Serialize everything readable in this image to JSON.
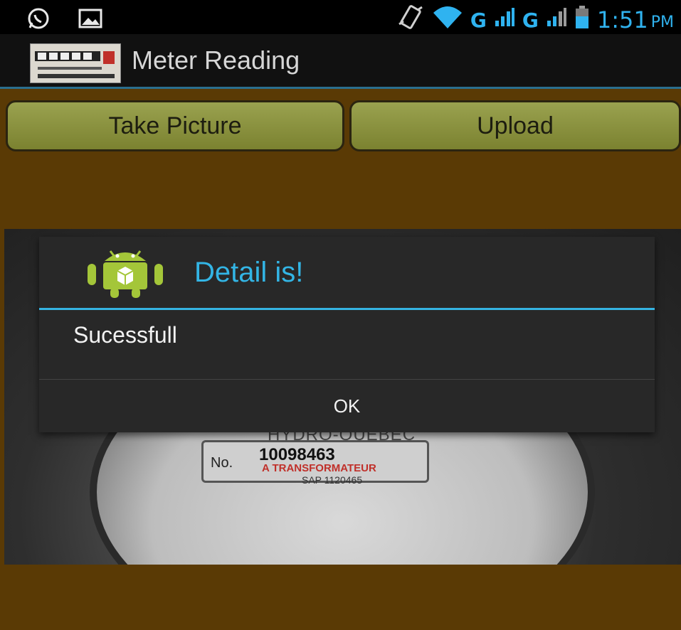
{
  "status_bar": {
    "left_icons": [
      "whatsapp-icon",
      "image-icon"
    ],
    "right_icons": [
      "vibrate-icon",
      "wifi-icon",
      "signal-icon",
      "signal-icon",
      "battery-icon"
    ],
    "network_1": "G",
    "network_2": "G",
    "time": "1:51",
    "ampm": "PM"
  },
  "action_bar": {
    "title": "Meter Reading",
    "icon": "meter-app-icon"
  },
  "buttons": {
    "take_picture": "Take Picture",
    "upload": "Upload"
  },
  "photo": {
    "brand": "HYDRO-QUEBEC",
    "no_label": "No.",
    "serial": "10098463",
    "red_text": "A TRANSFORMATEUR",
    "sap": "SAP 1120465"
  },
  "dialog": {
    "title": "Detail is!",
    "message": "Sucessfull",
    "ok": "OK"
  },
  "colors": {
    "accent": "#33b5e5",
    "background": "#5a3a05",
    "button": "#8f9640"
  }
}
